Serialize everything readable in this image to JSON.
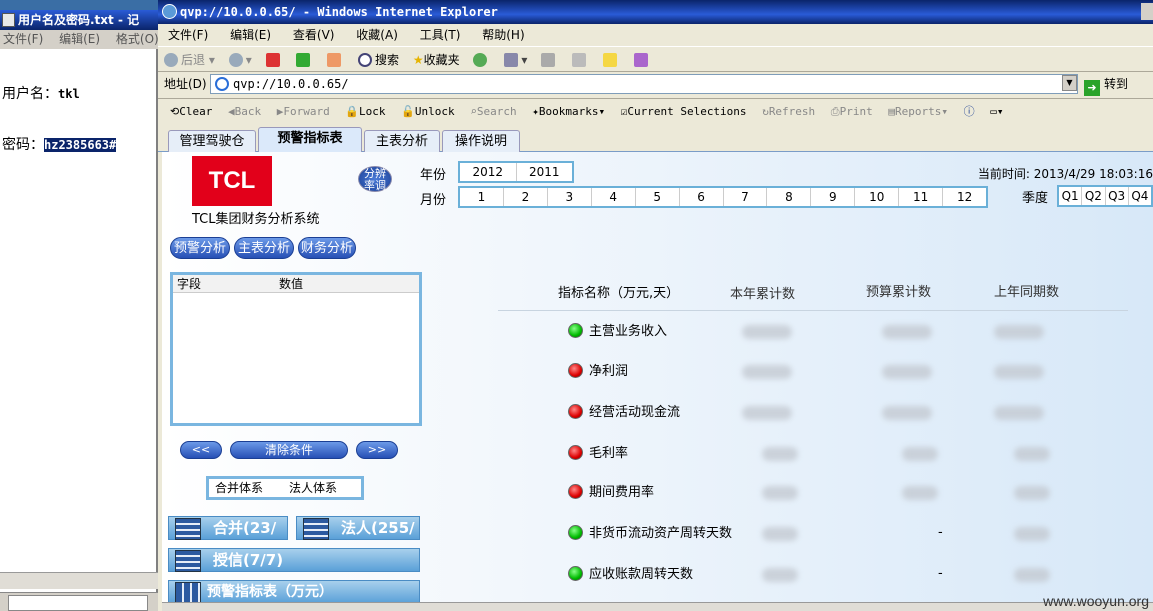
{
  "notepad": {
    "title": "用户名及密码.txt - 记",
    "menu": [
      "文件(F)",
      "编辑(E)",
      "格式(O)"
    ],
    "line1_label": "用户名：",
    "line1_value": "tkl",
    "line2_label": "密码：",
    "line2_value": "hz2385663#"
  },
  "browser": {
    "title": "qvp://10.0.0.65/ - Windows Internet Explorer",
    "menu": [
      "文件(F)",
      "编辑(E)",
      "查看(V)",
      "收藏(A)",
      "工具(T)",
      "帮助(H)"
    ],
    "toolbar": {
      "back": "后退",
      "search": "搜索",
      "favorites": "收藏夹"
    },
    "address_label": "地址(D)",
    "address": "qvp://10.0.0.65/",
    "go": "转到"
  },
  "qv_toolbar": [
    "Clear",
    "Back",
    "Forward",
    "Lock",
    "Unlock",
    "Search",
    "Bookmarks",
    "Current Selections",
    "Refresh",
    "Print",
    "Reports"
  ],
  "tabs": [
    "管理驾驶仓",
    "预警指标表",
    "主表分析",
    "操作说明"
  ],
  "logo_text": "TCL",
  "logo_caption": "TCL集团财务分析系统",
  "fenbian": "分辨率调",
  "year_label": "年份",
  "years": [
    "2012",
    "2011"
  ],
  "month_label": "月份",
  "months": [
    "1",
    "2",
    "3",
    "4",
    "5",
    "6",
    "7",
    "8",
    "9",
    "10",
    "11",
    "12"
  ],
  "quarter_label": "季度",
  "quarters": [
    "Q1",
    "Q2",
    "Q3",
    "Q4"
  ],
  "current_time": "当前时间: 2013/4/29 18:03:16",
  "left_buttons": [
    "预警分析",
    "主表分析",
    "财务分析"
  ],
  "listbox": {
    "col1": "字段",
    "col2": "数值"
  },
  "nav": {
    "prev": "<<",
    "clear": "清除条件",
    "next": ">>"
  },
  "tixi": [
    "合并体系",
    "法人体系"
  ],
  "categories": [
    "合并(23/",
    "法人(255/",
    "授信(7/7)",
    "预警指标表（万元）"
  ],
  "table": {
    "headers": [
      "指标名称（万元,天）",
      "本年累计数",
      "预算累计数",
      "上年同期数"
    ],
    "rows": [
      {
        "name": "主营业务收入",
        "status": "green"
      },
      {
        "name": "净利润",
        "status": "red"
      },
      {
        "name": "经营活动现金流",
        "status": "red"
      },
      {
        "name": "毛利率",
        "status": "red"
      },
      {
        "name": "期间费用率",
        "status": "red"
      },
      {
        "name": "非货币流动资产周转天数",
        "status": "green",
        "budget": "-"
      },
      {
        "name": "应收账款周转天数",
        "status": "green",
        "budget": "-"
      }
    ]
  },
  "watermark": "www.wooyun.org"
}
